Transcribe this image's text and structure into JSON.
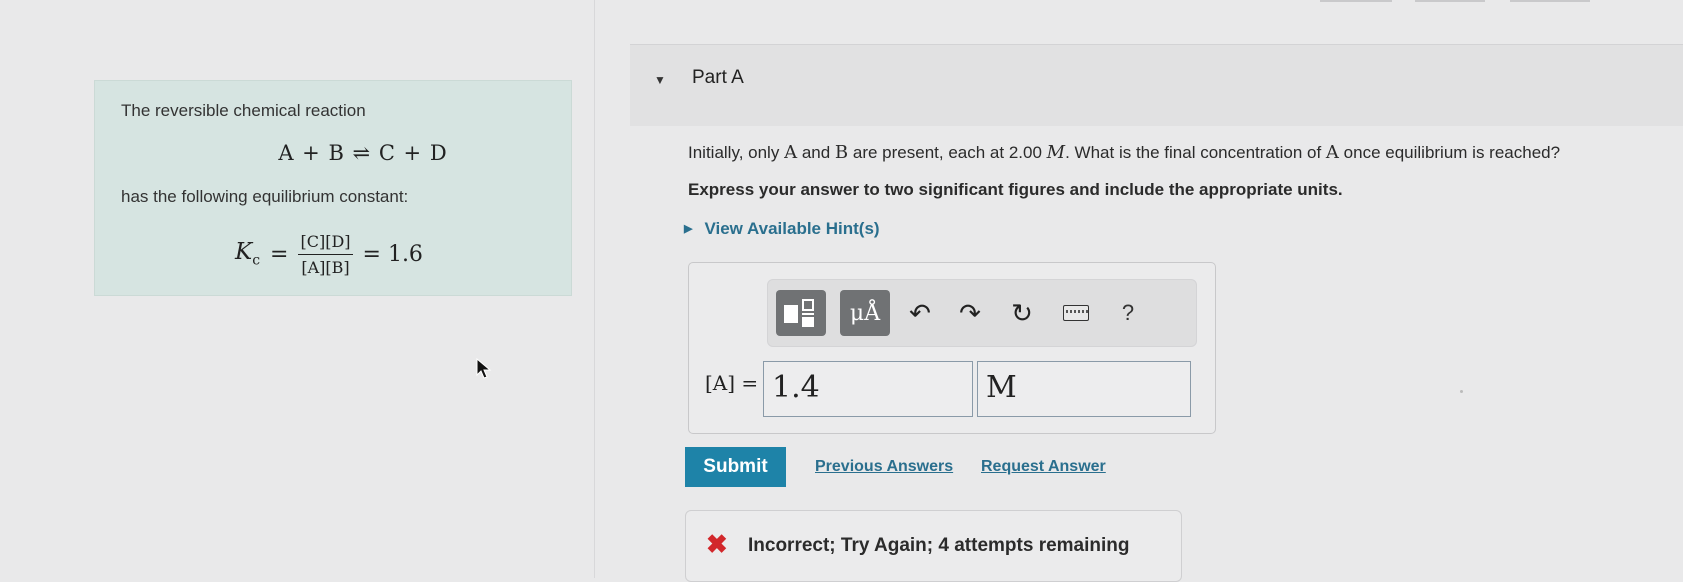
{
  "problem": {
    "intro_line1": "The reversible chemical reaction",
    "reaction": "A + B ⇌ C + D",
    "intro_line2": "has the following equilibrium constant:",
    "kc_symbol": "K",
    "kc_subscript": "c",
    "kc_numerator": "[C][D]",
    "kc_denominator": "[A][B]",
    "kc_value": "= 1.6"
  },
  "part": {
    "title": "Part A",
    "question_pre": "Initially, only",
    "q_species_A": "A",
    "q_and": "and",
    "q_species_B": "B",
    "q_mid": "are present, each at 2.00",
    "q_unit": "M",
    "q_post": ". What is the final concentration of",
    "q_species_A2": "A",
    "q_end": "once equilibrium is reached?",
    "instruction": "Express your answer to two significant figures and include the appropriate units.",
    "hints_label": "View Available Hint(s)"
  },
  "toolbar": {
    "units_label": "μÅ",
    "undo_glyph": "↶",
    "redo_glyph": "↷",
    "reset_glyph": "↻",
    "help_label": "?",
    "icons": [
      "templates-icon",
      "units-icon",
      "undo-icon",
      "redo-icon",
      "reset-icon",
      "keyboard-icon",
      "help-icon"
    ]
  },
  "answer": {
    "label": "[A] =",
    "value": "1.4",
    "unit": "M"
  },
  "actions": {
    "submit": "Submit",
    "previous_answers": "Previous Answers",
    "request_answer": "Request Answer"
  },
  "feedback": {
    "icon_glyph": "✖",
    "message": "Incorrect; Try Again; 4 attempts remaining"
  },
  "colors": {
    "accent": "#1e83a8",
    "link": "#2a6f8e",
    "error": "#d2272b",
    "intro_bg": "#d6e4e1"
  }
}
